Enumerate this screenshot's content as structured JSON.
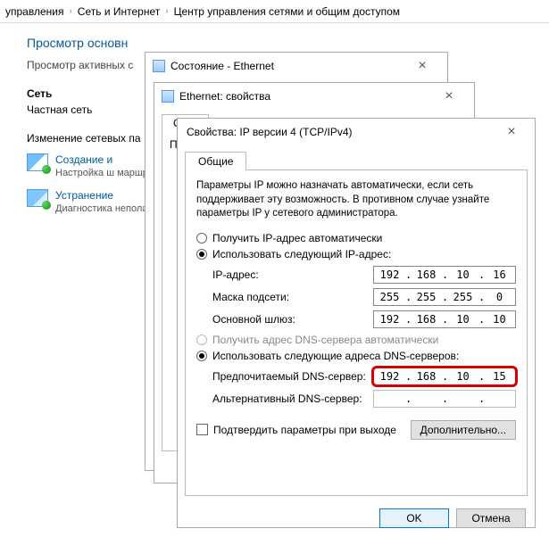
{
  "breadcrumb": {
    "a": "управления",
    "b": "Сеть и Интернет",
    "c": "Центр управления сетями и общим доступом"
  },
  "cp": {
    "heading": "Просмотр основн",
    "sub": "Просмотр активных с",
    "net_label": "Сеть",
    "net_kind": "Частная сеть",
    "change_label": "Изменение сетевых па",
    "task1": {
      "link": "Создание и",
      "sub": "Настройка ш\nмаршрутиза"
    },
    "task2": {
      "link": "Устранение",
      "sub": "Диагностика\nнеполадок."
    }
  },
  "win1": {
    "title": "Состояние - Ethernet"
  },
  "win2": {
    "title": "Ethernet: свойства",
    "tab": "Сеть",
    "line": "По"
  },
  "win3": {
    "title": "Свойства: IP версии 4 (TCP/IPv4)",
    "tab": "Общие",
    "para": "Параметры IP можно назначать автоматически, если сеть поддерживает эту возможность. В противном случае узнайте параметры IP у сетевого администратора.",
    "r_ip_auto": "Получить IP-адрес автоматически",
    "r_ip_manual": "Использовать следующий IP-адрес:",
    "lbl_ip": "IP-адрес:",
    "lbl_mask": "Маска подсети:",
    "lbl_gw": "Основной шлюз:",
    "ip": {
      "o1": "192",
      "o2": "168",
      "o3": "10",
      "o4": "16"
    },
    "mask": {
      "o1": "255",
      "o2": "255",
      "o3": "255",
      "o4": "0"
    },
    "gw": {
      "o1": "192",
      "o2": "168",
      "o3": "10",
      "o4": "10"
    },
    "r_dns_auto": "Получить адрес DNS-сервера автоматически",
    "r_dns_manual": "Использовать следующие адреса DNS-серверов:",
    "lbl_dns1": "Предпочитаемый DNS-сервер:",
    "lbl_dns2": "Альтернативный DNS-сервер:",
    "dns1": {
      "o1": "192",
      "o2": "168",
      "o3": "10",
      "o4": "15"
    },
    "dns2": {
      "o1": "",
      "o2": "",
      "o3": "",
      "o4": ""
    },
    "cb_validate": "Подтвердить параметры при выходе",
    "btn_adv": "Дополнительно...",
    "btn_ok": "OK",
    "btn_cancel": "Отмена"
  }
}
